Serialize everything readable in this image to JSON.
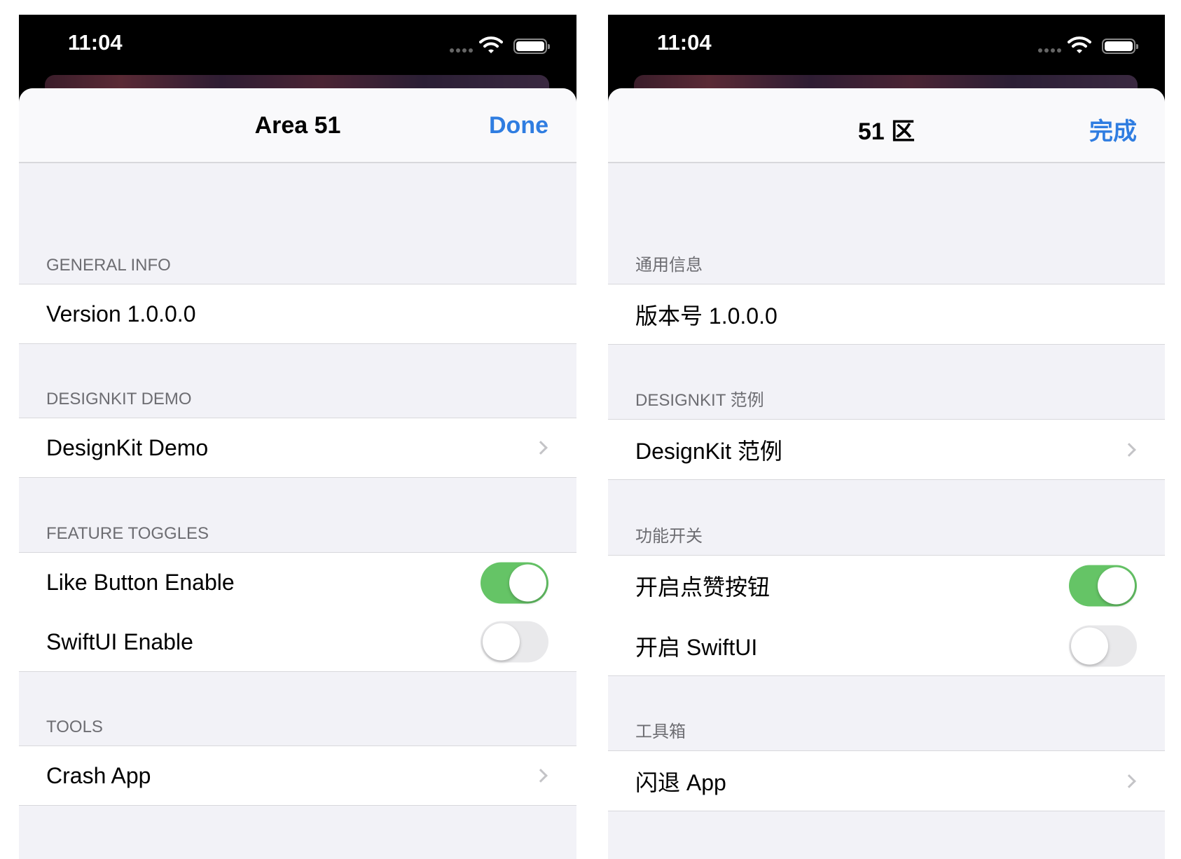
{
  "colors": {
    "accent": "#2f7de1",
    "toggle_on": "#65c466",
    "toggle_off": "#e9e9eb",
    "background": "#f2f2f7"
  },
  "panels": [
    {
      "status": {
        "time": "11:04"
      },
      "nav": {
        "title": "Area 51",
        "done": "Done"
      },
      "sections": [
        {
          "header": "GENERAL INFO",
          "rows": [
            {
              "label": "Version 1.0.0.0"
            }
          ]
        },
        {
          "header": "DESIGNKIT DEMO",
          "rows": [
            {
              "label": "DesignKit Demo",
              "accessory": "chevron-right-icon"
            }
          ]
        },
        {
          "header": "FEATURE TOGGLES",
          "rows": [
            {
              "label": "Like Button Enable",
              "toggle": true
            },
            {
              "label": "SwiftUI Enable",
              "toggle": false
            }
          ]
        },
        {
          "header": "TOOLS",
          "rows": [
            {
              "label": "Crash App",
              "accessory": "chevron-right-icon"
            }
          ]
        }
      ]
    },
    {
      "status": {
        "time": "11:04"
      },
      "nav": {
        "title": "51 区",
        "done": "完成"
      },
      "sections": [
        {
          "header": "通用信息",
          "rows": [
            {
              "label": "版本号 1.0.0.0"
            }
          ]
        },
        {
          "header": "DESIGNKIT 范例",
          "rows": [
            {
              "label": "DesignKit 范例",
              "accessory": "chevron-right-icon"
            }
          ]
        },
        {
          "header": "功能开关",
          "rows": [
            {
              "label": "开启点赞按钮",
              "toggle": true
            },
            {
              "label": "开启 SwiftUI",
              "toggle": false
            }
          ]
        },
        {
          "header": "工具箱",
          "rows": [
            {
              "label": "闪退 App",
              "accessory": "chevron-right-icon"
            }
          ]
        }
      ]
    }
  ]
}
